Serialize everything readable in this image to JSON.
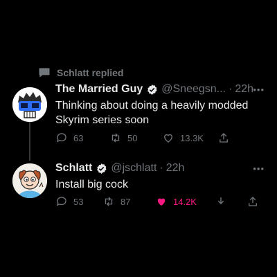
{
  "reply_context": {
    "text": "Schlatt replied"
  },
  "tweets": [
    {
      "name": "The Married Guy",
      "handle": "@Sneegsn...",
      "separator": "·",
      "time": "22h",
      "more": "•••",
      "text_lines": [
        "Thinking about doing a heavily modded",
        "Skyrim series soon"
      ],
      "replies": "63",
      "retweets": "50",
      "likes": "13.3K",
      "liked": false
    },
    {
      "name": "Schlatt",
      "handle": "@jschlatt",
      "separator": "·",
      "time": "22h",
      "more": "•••",
      "text_lines": [
        "Install big cock"
      ],
      "replies": "53",
      "retweets": "87",
      "likes": "14.2K",
      "liked": true
    }
  ],
  "colors": {
    "background": "#000000",
    "text": "#e7e9ea",
    "muted": "#71767b",
    "verified": "#e7e9ea",
    "like": "#f91880"
  },
  "icons": [
    "speech-bubble-icon",
    "verified-badge-icon",
    "reply-icon",
    "retweet-icon",
    "like-icon",
    "share-icon",
    "download-icon",
    "more-icon"
  ]
}
